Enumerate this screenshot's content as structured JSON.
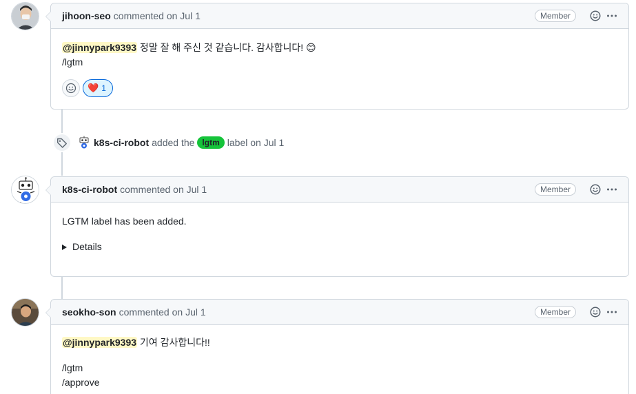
{
  "comments": [
    {
      "author": "jihoon-seo",
      "meta": "commented on Jul 1",
      "badge": "Member",
      "mention": "@jinnypark9393",
      "line1_rest": " 정말 잘 해 주신 것 같습니다. 감사합니다! 😊",
      "line2": "/lgtm",
      "reaction_emoji": "❤️",
      "reaction_count": "1"
    },
    {
      "author": "k8s-ci-robot",
      "meta": "commented on Jul 1",
      "badge": "Member",
      "line1": "LGTM label has been added.",
      "details": "Details"
    },
    {
      "author": "seokho-son",
      "meta": "commented on Jul 1",
      "badge": "Member",
      "mention": "@jinnypark9393",
      "line1_rest": " 기여 감사합니다!!",
      "line2": "/lgtm",
      "line3": "/approve"
    }
  ],
  "label_event": {
    "actor": "k8s-ci-robot",
    "text_before": "added the",
    "label": "lgtm",
    "label_color": "#15c43a",
    "text_after": "label on Jul 1"
  },
  "icons": {
    "tag": "tag-icon",
    "emoji": "smiley-icon",
    "menu": "kebab-horizontal-icon"
  }
}
